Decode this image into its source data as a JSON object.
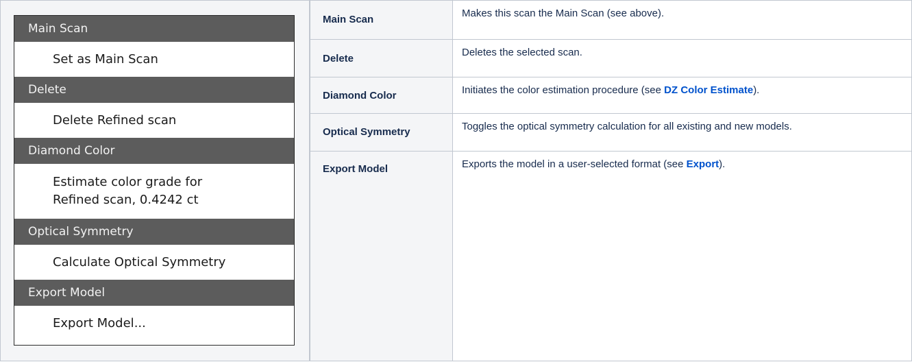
{
  "menu": {
    "sections": [
      {
        "header": "Main Scan",
        "items": [
          "Set as Main Scan"
        ]
      },
      {
        "header": "Delete",
        "items": [
          "Delete Refined scan"
        ]
      },
      {
        "header": "Diamond Color",
        "items": [
          "Estimate color grade for",
          "Refined scan, 0.4242 ct"
        ]
      },
      {
        "header": "Optical Symmetry",
        "items": [
          "Calculate Optical Symmetry"
        ]
      },
      {
        "header": "Export Model",
        "items": [
          "Export Model..."
        ]
      }
    ]
  },
  "table": {
    "rows": [
      {
        "name": "Main Scan",
        "desc": "Makes this scan the Main Scan (see above)."
      },
      {
        "name": "Delete",
        "desc": "Deletes the selected scan."
      },
      {
        "name": "Diamond Color",
        "desc_before": "Initiates the color estimation procedure (see ",
        "link": "DZ Color Estimate",
        "desc_after": ")."
      },
      {
        "name": "Optical Symmetry",
        "desc": "Toggles the optical symmetry calculation for all existing and new models."
      },
      {
        "name": "Export Model",
        "desc_before": "Exports the model in a user-selected format (see ",
        "link": "Export",
        "desc_after": ")."
      }
    ]
  },
  "colors": {
    "menu_header_bg": "#5c5c5c",
    "header_cell_bg": "#f4f5f7",
    "link": "#0052cc",
    "border": "#c1c7d0"
  }
}
